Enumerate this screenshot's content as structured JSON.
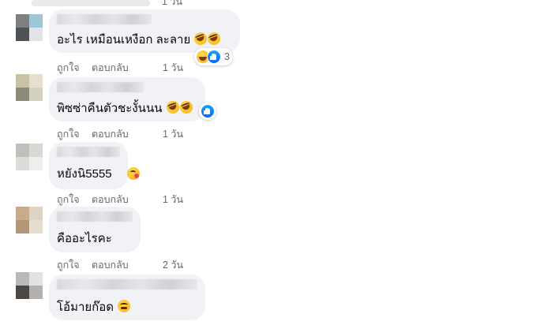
{
  "colors": {
    "bubble": "#f0f2f5",
    "action_text": "#65676b",
    "comment_text": "#050505",
    "like_blue": "#0866ff"
  },
  "top_partial": {
    "time": "1 วัน"
  },
  "comments": [
    {
      "text": "อะไร เหมือนเหงือก ละลาย",
      "emojis": [
        "rolling-on-floor-laughing",
        "rolling-on-floor-laughing"
      ],
      "reactions": {
        "icons": [
          "haha",
          "like"
        ],
        "count": "3"
      },
      "actions": {
        "like": "ถูกใจ",
        "reply": "ตอบกลับ",
        "time": "1 วัน"
      }
    },
    {
      "text": "พิซซ่าคืนตัวชะงั้นนน",
      "emojis": [
        "rolling-on-floor-laughing",
        "rolling-on-floor-laughing"
      ],
      "reactions": {
        "icons": [
          "like"
        ],
        "count": ""
      },
      "actions": {
        "like": "ถูกใจ",
        "reply": "ตอบกลับ",
        "time": "1 วัน"
      }
    },
    {
      "text": "หยังนิ5555",
      "emojis": [
        "hugging-face"
      ],
      "actions": {
        "like": "ถูกใจ",
        "reply": "ตอบกลับ",
        "time": "1 วัน"
      }
    },
    {
      "text": "คืออะไรคะ",
      "emojis": [],
      "actions": {
        "like": "ถูกใจ",
        "reply": "ตอบกลับ",
        "time": "2 วัน"
      }
    },
    {
      "text": "โอ้มายก๊อด",
      "emojis": [
        "persevering-face"
      ],
      "actions": {}
    }
  ]
}
